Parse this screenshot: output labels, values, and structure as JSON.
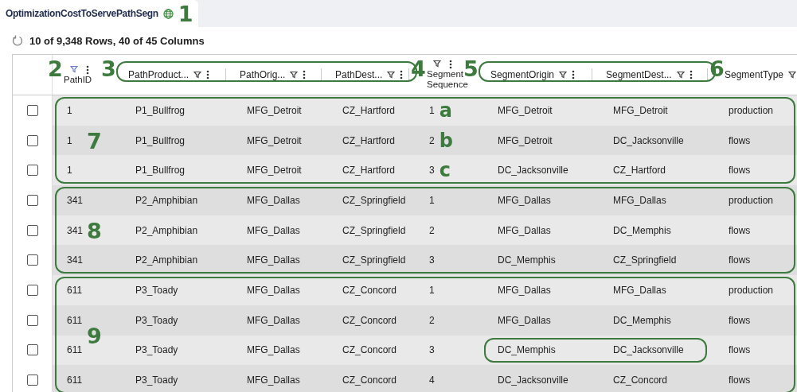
{
  "tab": {
    "title": "OptimizationCostToServePathSegn",
    "callout": "1"
  },
  "toolbar": {
    "summary": "10 of 9,348 Rows, 40 of 45 Columns"
  },
  "header_groups": [
    {
      "callout": "2",
      "outlined": false,
      "columns": [
        {
          "label": "PathID",
          "kind": "stacked",
          "filter_active": true,
          "menu": true
        }
      ]
    },
    {
      "callout": "3",
      "outlined": true,
      "columns": [
        {
          "label": "PathProduct...",
          "kind": "inline",
          "filter_active": false,
          "menu": true
        },
        {
          "label": "PathOrig...",
          "kind": "inline",
          "filter_active": false,
          "menu": true
        },
        {
          "label": "PathDest...",
          "kind": "inline",
          "filter_active": false,
          "menu": true
        }
      ]
    },
    {
      "callout": "4",
      "outlined": false,
      "columns": [
        {
          "label": "Segment Sequence",
          "kind": "stacked",
          "filter_active": false,
          "menu": true
        }
      ]
    },
    {
      "callout": "5",
      "outlined": true,
      "columns": [
        {
          "label": "SegmentOrigin",
          "kind": "inline",
          "filter_active": false,
          "menu": true
        },
        {
          "label": "SegmentDest...",
          "kind": "inline",
          "filter_active": false,
          "menu": true
        }
      ]
    },
    {
      "callout": "6",
      "outlined": false,
      "columns": [
        {
          "label": "SegmentType",
          "kind": "inline",
          "filter_active": false,
          "menu": false
        }
      ]
    }
  ],
  "row_groups": [
    {
      "callout": "7",
      "rows": [
        {
          "checked": false,
          "highlight_segment": false,
          "marker": "a",
          "cells": [
            "1",
            "P1_Bullfrog",
            "MFG_Detroit",
            "CZ_Hartford",
            "1",
            "MFG_Detroit",
            "MFG_Detroit",
            "production"
          ]
        },
        {
          "checked": false,
          "highlight_segment": false,
          "marker": "b",
          "cells": [
            "1",
            "P1_Bullfrog",
            "MFG_Detroit",
            "CZ_Hartford",
            "2",
            "MFG_Detroit",
            "DC_Jacksonville",
            "flows"
          ]
        },
        {
          "checked": false,
          "highlight_segment": false,
          "marker": "c",
          "cells": [
            "1",
            "P1_Bullfrog",
            "MFG_Detroit",
            "CZ_Hartford",
            "3",
            "DC_Jacksonville",
            "CZ_Hartford",
            "flows"
          ]
        }
      ]
    },
    {
      "callout": "8",
      "rows": [
        {
          "checked": false,
          "highlight_segment": false,
          "cells": [
            "341",
            "P2_Amphibian",
            "MFG_Dallas",
            "CZ_Springfield",
            "1",
            "MFG_Dallas",
            "MFG_Dallas",
            "production"
          ]
        },
        {
          "checked": false,
          "highlight_segment": false,
          "cells": [
            "341",
            "P2_Amphibian",
            "MFG_Dallas",
            "CZ_Springfield",
            "2",
            "MFG_Dallas",
            "DC_Memphis",
            "flows"
          ]
        },
        {
          "checked": false,
          "highlight_segment": false,
          "cells": [
            "341",
            "P2_Amphibian",
            "MFG_Dallas",
            "CZ_Springfield",
            "3",
            "DC_Memphis",
            "CZ_Springfield",
            "flows"
          ]
        }
      ]
    },
    {
      "callout": "9",
      "rows": [
        {
          "checked": false,
          "highlight_segment": false,
          "cells": [
            "611",
            "P3_Toady",
            "MFG_Dallas",
            "CZ_Concord",
            "1",
            "MFG_Dallas",
            "MFG_Dallas",
            "production"
          ]
        },
        {
          "checked": false,
          "highlight_segment": false,
          "cells": [
            "611",
            "P3_Toady",
            "MFG_Dallas",
            "CZ_Concord",
            "2",
            "MFG_Dallas",
            "DC_Memphis",
            "flows"
          ]
        },
        {
          "checked": false,
          "highlight_segment": true,
          "cells": [
            "611",
            "P3_Toady",
            "MFG_Dallas",
            "CZ_Concord",
            "3",
            "DC_Memphis",
            "DC_Jacksonville",
            "flows"
          ]
        },
        {
          "checked": false,
          "highlight_segment": false,
          "cells": [
            "611",
            "P3_Toady",
            "MFG_Dallas",
            "CZ_Concord",
            "4",
            "DC_Jacksonville",
            "CZ_Concord",
            "flows"
          ]
        }
      ]
    }
  ]
}
